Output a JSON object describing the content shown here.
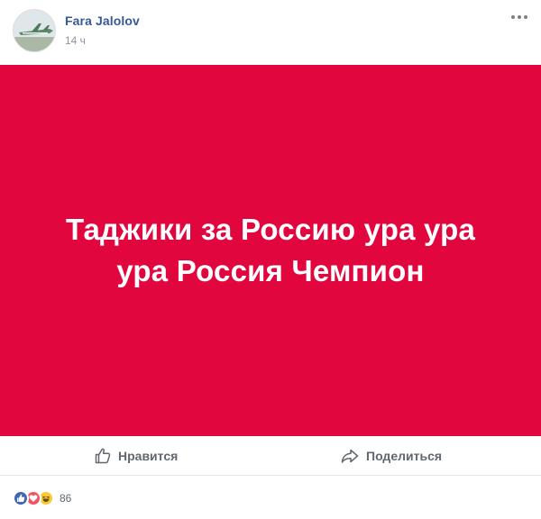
{
  "post": {
    "author_name": "Fara Jalolov",
    "timestamp": "14 ч",
    "banner_text": "Таджики за Россию ура ура ура Россия Чемпион",
    "banner_color": "#e2063f"
  },
  "actions": {
    "like_label": "Нравится",
    "share_label": "Поделиться"
  },
  "reactions": {
    "icons": [
      "like-icon",
      "love-icon",
      "haha-icon"
    ],
    "count": "86"
  },
  "colors": {
    "author_link": "#365899",
    "meta_text": "#90949c",
    "action_text": "#606770",
    "like_blue": "#4267b2",
    "love_red": "#f25268",
    "haha_yellow": "#f7c937"
  }
}
